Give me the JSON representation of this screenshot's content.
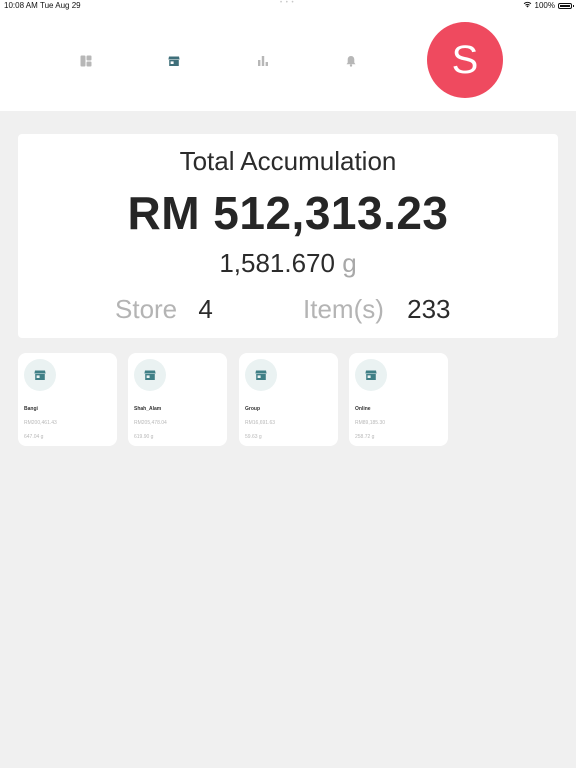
{
  "status_bar": {
    "time": "10:08 AM",
    "date": "Tue Aug 29",
    "dots": "• • •",
    "battery": "100%",
    "battery_level": 1.0
  },
  "nav": {
    "items": [
      {
        "icon": "dashboard-icon",
        "active": false
      },
      {
        "icon": "store-icon",
        "active": true
      },
      {
        "icon": "bar-chart-icon",
        "active": false
      },
      {
        "icon": "bell-icon",
        "active": false
      }
    ],
    "avatar_initial": "S",
    "avatar_color": "#ef4a5f",
    "active_color": "#3f6f7a",
    "inactive_color": "#b7b7b7"
  },
  "summary": {
    "title": "Total Accumulation",
    "amount": "RM 512,313.23",
    "weight_value": "1,581.670",
    "weight_unit": "g",
    "store_label": "Store",
    "store_count": "4",
    "items_label": "Item(s)",
    "items_count": "233"
  },
  "stores": [
    {
      "name": "Bangi",
      "amount": "RM200,461.43",
      "weight": "647.04 g"
    },
    {
      "name": "Shah_Alam",
      "amount": "RM205,478.04",
      "weight": "619.90 g"
    },
    {
      "name": "Group",
      "amount": "RM16,691.63",
      "weight": "59.63 g"
    },
    {
      "name": "Online",
      "amount": "RM89,185.30",
      "weight": "258.72 g"
    }
  ]
}
